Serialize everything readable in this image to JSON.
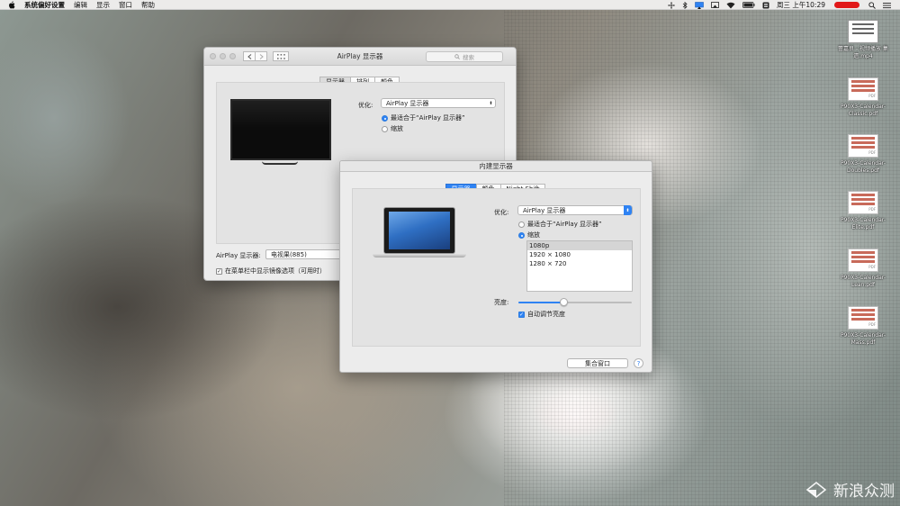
{
  "menubar": {
    "app_name": "系统偏好设置",
    "items": [
      "编辑",
      "显示",
      "窗口",
      "帮助"
    ],
    "clock": "周三 上午10:29"
  },
  "desktop_icons": [
    {
      "label": "蕾嘉良 - 视频播放 集\n遗.mp4",
      "kind": "video"
    },
    {
      "label": "P90X3-Calendar-\nClassic.pdf",
      "kind": "pdf"
    },
    {
      "label": "P90X3-Calendar-\nDoubles.pdf",
      "kind": "pdf"
    },
    {
      "label": "P90X3-Calendar-\nElite.pdf",
      "kind": "pdf"
    },
    {
      "label": "P90X3-Calendar-\nLean.pdf",
      "kind": "pdf"
    },
    {
      "label": "P90X3-Calendar-\nMass.pdf",
      "kind": "pdf"
    }
  ],
  "airplay_window": {
    "title": "AirPlay 显示器",
    "search_placeholder": "搜索",
    "tabs": [
      "显示器",
      "排列",
      "颜色"
    ],
    "optimize_label": "优化:",
    "optimize_value": "AirPlay 显示器",
    "radio_best": "最适合于“AirPlay 显示器”",
    "radio_scaled": "缩放",
    "airplay_display_label": "AirPlay 显示器:",
    "airplay_display_value": "电视果(885)",
    "mirror_option": "在菜单栏中显示镜像选项（可用时）"
  },
  "builtin_window": {
    "title": "内建显示器",
    "tabs": [
      "显示器",
      "颜色",
      "Night Shift"
    ],
    "optimize_label": "优化:",
    "optimize_value": "AirPlay 显示器",
    "radio_best": "最适合于“AirPlay 显示器”",
    "radio_scaled": "缩放",
    "resolutions": [
      "1080p",
      "1920 × 1080",
      "1280 × 720"
    ],
    "brightness_label": "亮度:",
    "brightness_level": 0.4,
    "auto_brightness": "自动调节亮度",
    "gather_button": "集合窗口",
    "help_glyph": "?"
  },
  "watermark": {
    "text": "新浪众测"
  }
}
